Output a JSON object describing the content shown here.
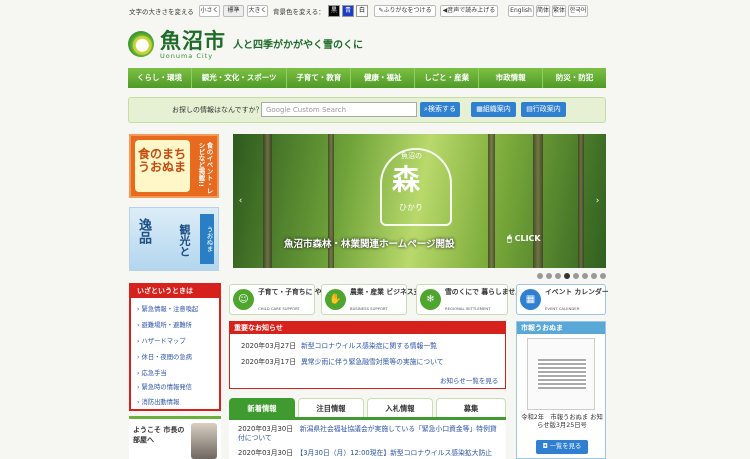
{
  "utility": {
    "font_size_label": "文字の大きさを変える",
    "font_sizes": [
      "小さく",
      "標準",
      "大きく"
    ],
    "bgcolor_label": "背景色を変える：",
    "bg_colors": [
      "黒",
      "青",
      "白"
    ],
    "furigana": "ふりがなをつける",
    "read_aloud": "音声で読み上げる",
    "languages": [
      "English",
      "简体",
      "繁体",
      "한국어"
    ]
  },
  "header": {
    "city_name": "魚沼市",
    "city_en": "Uonuma City",
    "tagline": "人と四季がかがやく雪のくに"
  },
  "nav": [
    "くらし・環境",
    "観光・文化・スポーツ",
    "子育て・教育",
    "健康・福祉",
    "しごと・産業",
    "市政情報",
    "防災・防犯"
  ],
  "search": {
    "label": "お探しの情報はなんですか？",
    "placeholder": "Google Custom Search",
    "search_btn": "検索する",
    "org_btn": "組織案内",
    "office_btn": "行政案内"
  },
  "banners": {
    "food_title": "食のまち うおぬま",
    "food_side": "食のイベント・レシピなど掲載!!",
    "tour_title": "逸品",
    "tour_side": "うおぬま",
    "tour_main": "観光と"
  },
  "slide": {
    "logo_top": "魚沼の",
    "logo_main": "森",
    "logo_sub": "ひかり",
    "caption": "魚沼市森林・林業関連ホームページ開設",
    "click": "CLICK",
    "dots": 8,
    "active_dot": 3
  },
  "emergency": {
    "title": "いざというときは",
    "items": [
      "緊急情報・注意喚起",
      "避難場所・避難所",
      "ハザードマップ",
      "休日・夜間の急病",
      "応急手当",
      "緊急時の情報発信",
      "消防出動情報"
    ]
  },
  "mayor": {
    "label": "ようこそ 市長の部屋へ"
  },
  "categories": [
    {
      "title": "子育て・子育ちに やさしいまち",
      "en": "CHILD CARE SUPPORT",
      "icon": "child-icon",
      "color": "#3f9a2f"
    },
    {
      "title": "農業・産業 ビジネス支援",
      "en": "BUSINESS SUPPORT",
      "icon": "handshake-icon",
      "color": "#3f9a2f"
    },
    {
      "title": "雪のくにで 暮らしませんか",
      "en": "REGIONAL SETTLEMENT",
      "icon": "snow-icon",
      "color": "#3f9a2f"
    },
    {
      "title": "イベント カレンダー",
      "en": "EVENT CALENDER",
      "icon": "calendar-icon",
      "color": "#2f80d0"
    }
  ],
  "notice": {
    "title": "重要なお知らせ",
    "items": [
      {
        "date": "2020年03月27日",
        "text": "新型コロナウイルス感染症に関する情報一覧"
      },
      {
        "date": "2020年03月17日",
        "text": "異常少雨に伴う緊急融雪対策等の実施について"
      }
    ],
    "more": "お知らせ一覧を見る"
  },
  "tabs": [
    "新着情報",
    "注目情報",
    "入札情報",
    "募集"
  ],
  "news": [
    {
      "date": "2020年03月30日",
      "text": "新潟県社会福祉協議会が実施している「緊急小口資金等」特例貸付について"
    },
    {
      "date": "2020年03月30日",
      "text": "【3月30日（月）12:00現在】新型コロナウイルス感染拡大防止"
    }
  ],
  "koho": {
    "title": "市報うおぬま",
    "caption": "令和2年　市報うおぬま お知らせ版3月25日号",
    "btn": "一覧を見る"
  },
  "colors": {
    "green": "#3f9a2f",
    "red": "#d7211c",
    "blue": "#2f80d0"
  }
}
